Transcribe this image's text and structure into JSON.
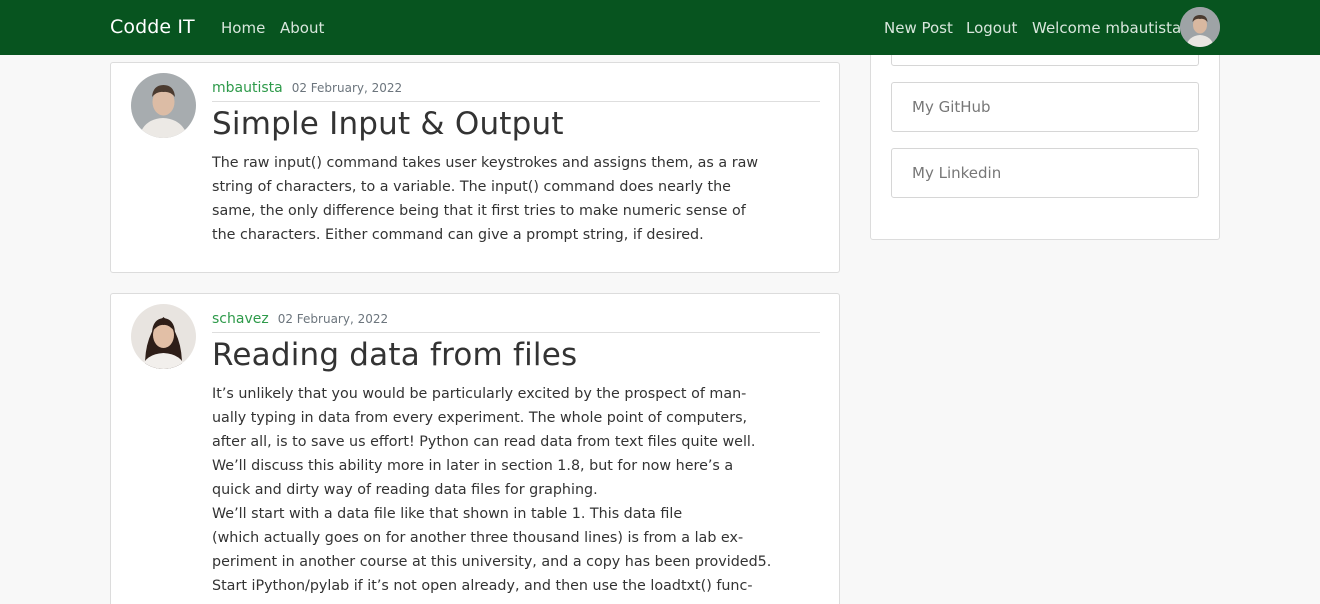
{
  "navbar": {
    "brand": "Codde IT",
    "left_links": [
      "Home",
      "About"
    ],
    "new_post": "New Post",
    "logout": "Logout",
    "welcome": "Welcome mbautista"
  },
  "posts": [
    {
      "author": "mbautista",
      "date": "02 February, 2022",
      "title": "Simple Input & Output",
      "content_lines": [
        "The raw input() command takes user keystrokes and assigns them, as a raw",
        "string of characters, to a variable. The input() command does nearly the",
        "same, the only difference being that it first tries to make numeric sense of",
        "the characters. Either command can give a prompt string, if desired."
      ]
    },
    {
      "author": "schavez",
      "date": "02 February, 2022",
      "title": "Reading data from files",
      "content_lines": [
        "It’s unlikely that you would be particularly excited by the prospect of man-",
        "ually typing in data from every experiment. The whole point of computers,",
        "after all, is to save us effort! Python can read data from text files quite well.",
        "We’ll discuss this ability more in later in section 1.8, but for now here’s a",
        "quick and dirty way of reading data files for graphing.",
        "We’ll start with a data file like that shown in table 1. This data file",
        "(which actually goes on for another three thousand lines) is from a lab ex-",
        "periment in another course at this university, and a copy has been provided5.",
        "Start iPython/pylab if it’s not open already, and then use the loadtxt() func-"
      ]
    }
  ],
  "sidebar": {
    "items": [
      "My GitHub",
      "My Linkedin"
    ]
  },
  "colors": {
    "navbar_bg": "#07541f",
    "author_link": "#2e9a4a"
  }
}
